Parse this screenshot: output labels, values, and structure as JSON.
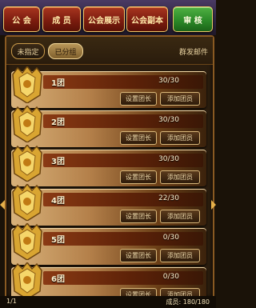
{
  "tabs": [
    {
      "label": "公 会",
      "active": false
    },
    {
      "label": "成 员",
      "active": false
    },
    {
      "label": "公会展示",
      "active": false
    },
    {
      "label": "公会副本",
      "active": false
    },
    {
      "label": "审 核",
      "active": true
    }
  ],
  "filters": {
    "unassigned": "未指定",
    "assigned": "已分组",
    "mail": "群发邮件"
  },
  "groups": [
    {
      "name": "1团",
      "count": "30/30"
    },
    {
      "name": "2团",
      "count": "30/30"
    },
    {
      "name": "3团",
      "count": "30/30"
    },
    {
      "name": "4团",
      "count": "22/30"
    },
    {
      "name": "5团",
      "count": "0/30"
    },
    {
      "name": "6团",
      "count": "0/30"
    }
  ],
  "buttons": {
    "set_leader": "设置团长",
    "add_member": "添加团员"
  },
  "footer": {
    "page": "1/1",
    "members_label": "成员:",
    "members_value": "180/180"
  },
  "colors": {
    "active_tab": "#2c8a28",
    "tab": "#7c1c0f",
    "accent_gold": "#e6b04a"
  }
}
